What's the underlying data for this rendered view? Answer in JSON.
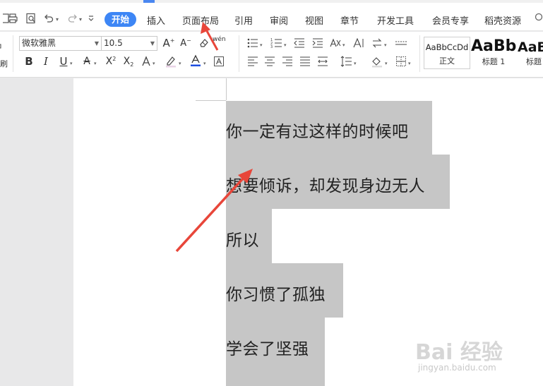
{
  "menu": {
    "tabs": [
      {
        "label": "开始",
        "active": true
      },
      {
        "label": "插入"
      },
      {
        "label": "页面布局"
      },
      {
        "label": "引用"
      },
      {
        "label": "审阅"
      },
      {
        "label": "视图"
      },
      {
        "label": "章节"
      },
      {
        "label": "开发工具"
      },
      {
        "label": "会员专享"
      },
      {
        "label": "稻壳资源"
      }
    ]
  },
  "ribbon": {
    "clipboard_partial_label": "刷",
    "font_name": "微软雅黑",
    "font_size": "10.5",
    "pinyin_label": "wén",
    "styles": [
      {
        "sample": "AaBbCcDd",
        "name": "正文"
      },
      {
        "sample": "AaBb",
        "name": "标题 1"
      },
      {
        "sample": "AaB",
        "name": "标题"
      }
    ]
  },
  "document": {
    "lines": [
      "你一定有过这样的时候吧",
      "想要倾诉，却发现身边无人",
      "所以",
      "你习惯了孤独",
      "学会了坚强"
    ],
    "selection_color": "#c6c6c6"
  },
  "annotation": {
    "arrow_color": "#e8463a"
  },
  "watermark": {
    "main": "Bai 经验",
    "sub": "jingyan.baidu.com"
  },
  "accent_color": "#3d86f5"
}
